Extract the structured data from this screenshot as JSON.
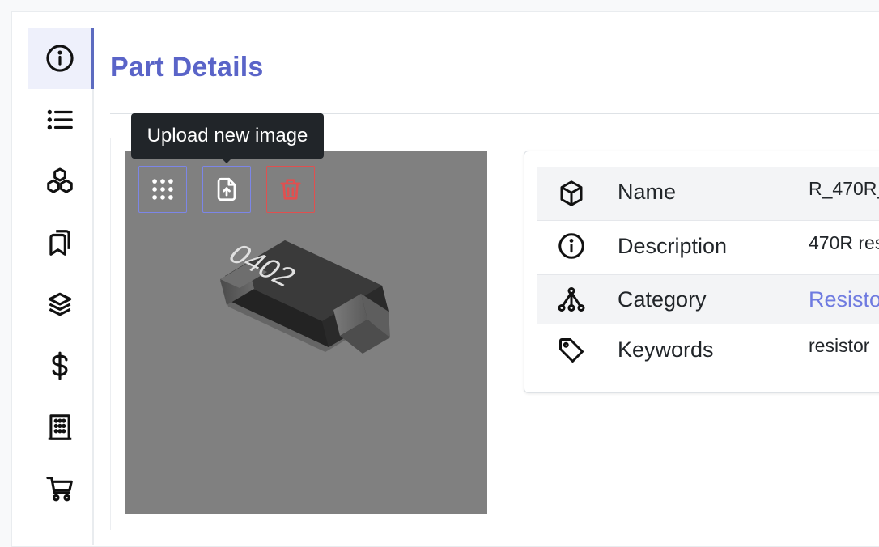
{
  "page": {
    "title": "Part Details"
  },
  "sidebar": {
    "items": [
      {
        "icon": "info-circle-icon",
        "active": true
      },
      {
        "icon": "list-icon",
        "active": false
      },
      {
        "icon": "cubes-icon",
        "active": false
      },
      {
        "icon": "bookmarks-icon",
        "active": false
      },
      {
        "icon": "layers-icon",
        "active": false
      },
      {
        "icon": "dollar-icon",
        "active": false
      },
      {
        "icon": "building-icon",
        "active": false
      },
      {
        "icon": "cart-icon",
        "active": false
      }
    ]
  },
  "image_panel": {
    "tooltip": "Upload new image",
    "chip_marking": "0402",
    "buttons": [
      {
        "icon": "grid-dots-icon"
      },
      {
        "icon": "file-upload-icon"
      },
      {
        "icon": "trash-icon"
      }
    ]
  },
  "properties": [
    {
      "icon": "box-icon",
      "label": "Name",
      "value": "R_470R_"
    },
    {
      "icon": "info-circle-icon",
      "label": "Description",
      "value": "470R res"
    },
    {
      "icon": "category-tree-icon",
      "label": "Category",
      "value": "Resisto",
      "is_link": true
    },
    {
      "icon": "tag-icon",
      "label": "Keywords",
      "value": "resistor"
    }
  ],
  "colors": {
    "accent": "#5a64c8",
    "link": "#6f7be0",
    "danger": "#e05050",
    "tooltip_bg": "#212529",
    "image_bg": "#808080"
  }
}
